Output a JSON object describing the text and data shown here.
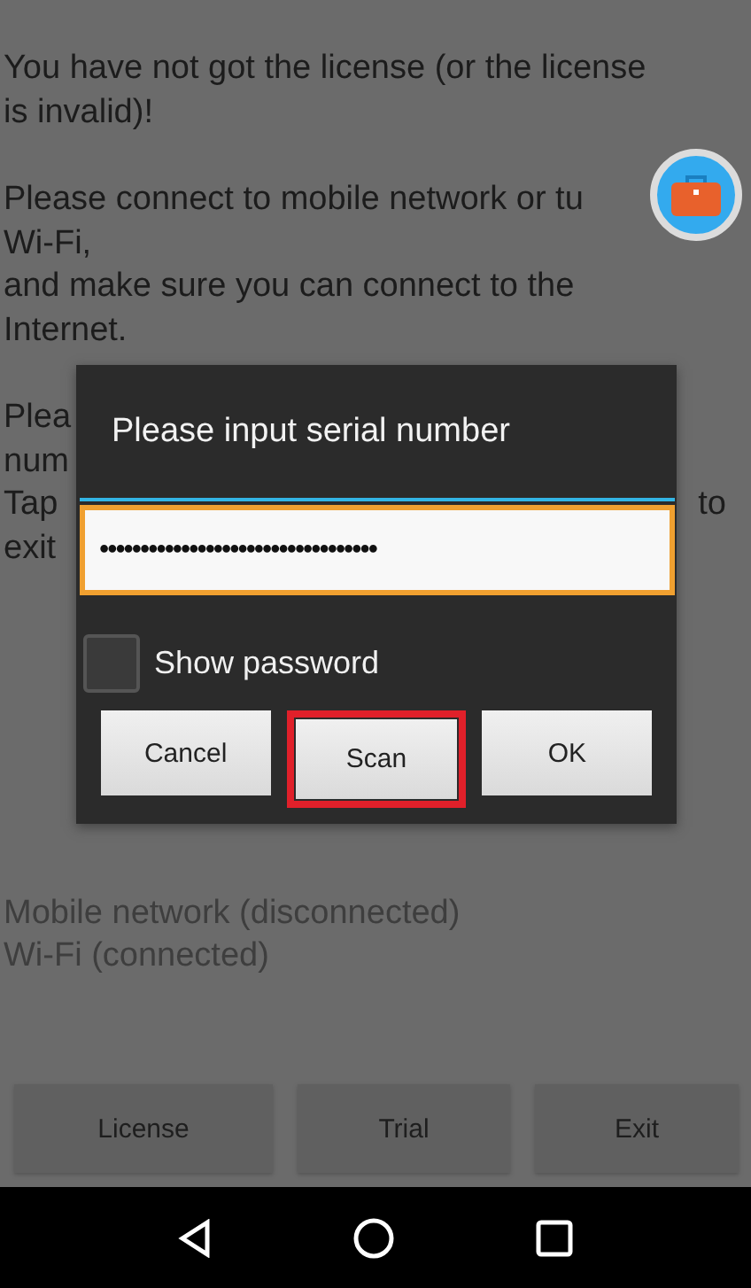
{
  "message_paragraphs": [
    [
      "You have not got the license (or the license",
      "is invalid)!"
    ],
    [
      "Please connect to mobile network or tu",
      "Wi-Fi,",
      "and make sure you can connect to the",
      "Internet."
    ]
  ],
  "covered_paragraph": [
    {
      "left": "Plea"
    },
    {
      "left": "num"
    },
    {
      "left": "Tap",
      "right": "to"
    },
    {
      "left": "exit"
    }
  ],
  "network_status": [
    "Mobile network (disconnected)",
    "Wi-Fi (connected)"
  ],
  "bottom_buttons": [
    "License",
    "Trial",
    "Exit"
  ],
  "dialog": {
    "title": "Please input serial number",
    "field": {
      "value": "••••••••••••••••••••••••••••••••••"
    },
    "show_password": {
      "label": "Show password",
      "checked": false
    },
    "buttons": [
      {
        "label": "Cancel",
        "highlighted": false
      },
      {
        "label": "Scan",
        "highlighted": true
      },
      {
        "label": "OK",
        "highlighted": false
      }
    ]
  }
}
